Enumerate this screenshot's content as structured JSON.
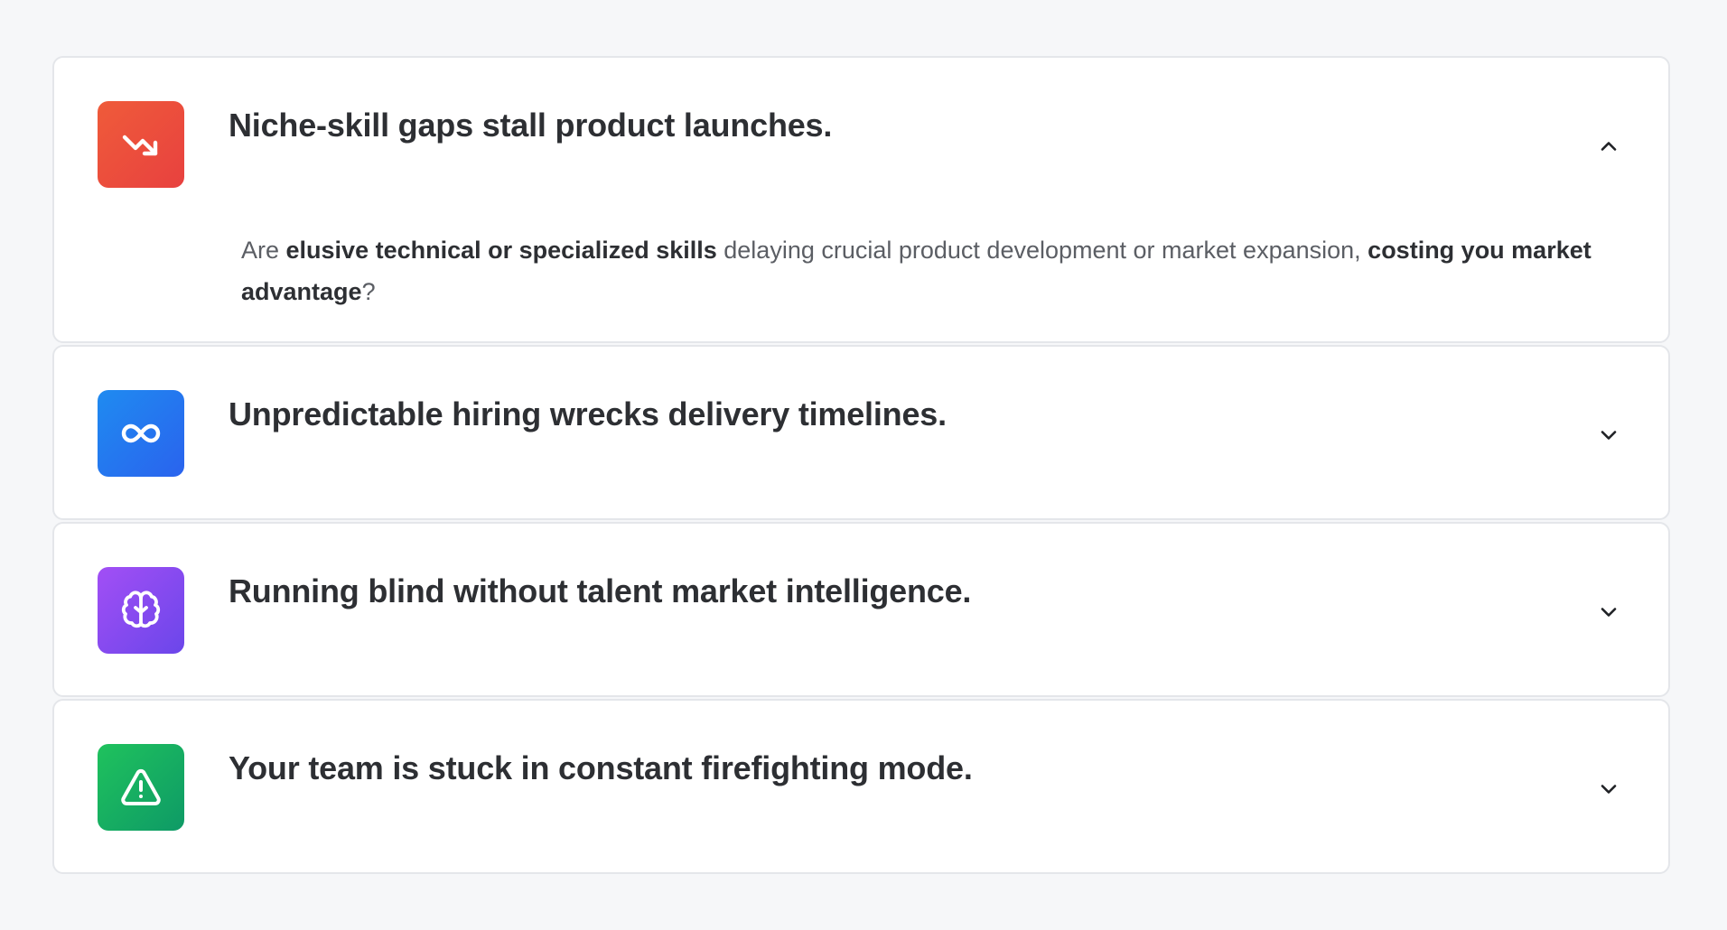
{
  "accordion": {
    "items": [
      {
        "title": "Niche-skill gaps stall product launches.",
        "icon": "trending-down-icon",
        "expanded": true,
        "body": {
          "t1": "Are ",
          "b1": "elusive technical or specialized skills",
          "t2": " delaying crucial product development or market expansion, ",
          "b2": "costing you market advantage",
          "t3": "?"
        }
      },
      {
        "title": "Unpredictable hiring wrecks delivery timelines.",
        "icon": "infinity-icon",
        "expanded": false
      },
      {
        "title": "Running blind without talent market intelligence.",
        "icon": "brain-icon",
        "expanded": false
      },
      {
        "title": "Your team is stuck in constant firefighting mode.",
        "icon": "warning-triangle-icon",
        "expanded": false
      }
    ]
  },
  "colors": {
    "red": "#e8413f",
    "blue": "#2a63ee",
    "purple": "#6b46ea",
    "green": "#0e9a66"
  }
}
